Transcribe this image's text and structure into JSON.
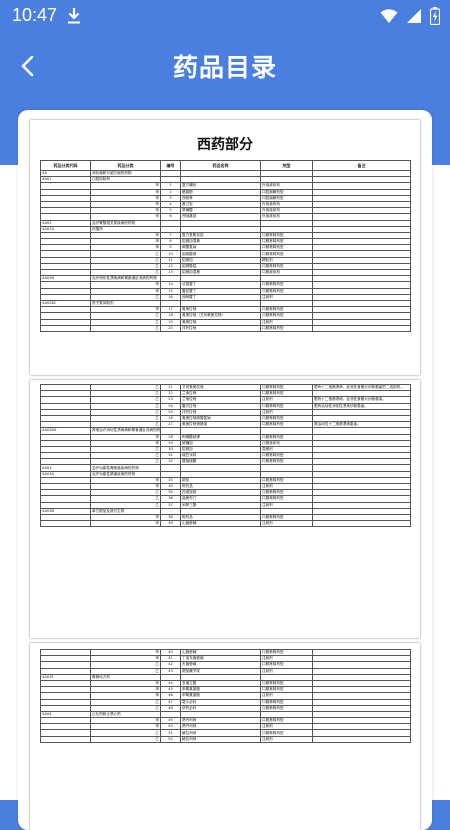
{
  "status": {
    "time": "10:47"
  },
  "header": {
    "title": "药品目录"
  },
  "document": {
    "title": "西药部分",
    "columns": [
      "药品分类代码",
      "药品分类",
      "编号",
      "药品名称",
      "剂型",
      "备注"
    ],
    "page1_rows": [
      [
        "XA",
        "消化道和代谢方面的药物",
        "",
        "",
        "",
        ""
      ],
      [
        "XA01",
        "口腔科制剂",
        "",
        "",
        "",
        ""
      ],
      [
        "",
        "甲",
        "1",
        "复方硼砂",
        "外用液体剂",
        ""
      ],
      [
        "",
        "甲",
        "2",
        "醋氯酚",
        "口腔崩解剂型",
        ""
      ],
      [
        "",
        "甲",
        "3",
        "西帕林",
        "口腔崩解剂型",
        ""
      ],
      [
        "",
        "甲",
        "4",
        "氯己定",
        "外用液体剂",
        ""
      ],
      [
        "",
        "甲",
        "5",
        "草磺酸",
        "外用液体剂",
        ""
      ],
      [
        "",
        "甲",
        "6",
        "西吡氯铵",
        "外用液体剂",
        ""
      ],
      [
        "XA02",
        "治疗胃酸相关类疾病的药物",
        "",
        "",
        "",
        ""
      ],
      [
        "XA02A",
        "抗酸药",
        "",
        "",
        "",
        ""
      ],
      [
        "",
        "甲",
        "7",
        "复方氢氧化铝",
        "口服常释剂型",
        ""
      ],
      [
        "",
        "甲",
        "8",
        "铝镁加混悬",
        "口服常释剂型",
        ""
      ],
      [
        "",
        "甲",
        "9",
        "碳酸氢钠",
        "口服常释剂型",
        ""
      ],
      [
        "",
        "乙",
        "10",
        "铝碳酸镁",
        "口服常释剂型",
        ""
      ],
      [
        "",
        "乙",
        "11",
        "铝镁加",
        "颗粒剂",
        ""
      ],
      [
        "",
        "乙",
        "12",
        "铝镁酸铝",
        "口服常释剂型",
        ""
      ],
      [
        "",
        "乙",
        "13",
        "铝镁加混悬",
        "口服液体剂",
        ""
      ],
      [
        "XA02B",
        "治疗消化性溃疡病和胃食道反流病的药物",
        "",
        "",
        "",
        ""
      ],
      [
        "",
        "甲",
        "14",
        "法莫替丁",
        "口服常释剂型",
        ""
      ],
      [
        "",
        "甲",
        "15",
        "雷尼替丁",
        "口服常释剂型",
        ""
      ],
      [
        "",
        "乙",
        "16",
        "西咪替丁",
        "注射剂",
        ""
      ],
      [
        "XA02BC",
        "质子泵抑制剂",
        "",
        "",
        "",
        ""
      ],
      [
        "",
        "甲",
        "17",
        "奥美拉唑",
        "口服常释剂型",
        ""
      ],
      [
        "",
        "乙",
        "18",
        "奥美拉唑（艾司奥美拉唑）",
        "口服常释剂型",
        ""
      ],
      [
        "",
        "乙",
        "19",
        "奥美拉唑",
        "注射剂",
        ""
      ],
      [
        "",
        "乙",
        "20",
        "泮托拉唑",
        "口服常释剂型",
        ""
      ]
    ],
    "page2_rows": [
      [
        "",
        "乙",
        "21",
        "艾司奥美拉唑",
        "口服常释剂型",
        "限有十二指肠溃疡、反流性食管炎诊断患者的二线用药。"
      ],
      [
        "",
        "乙",
        "22",
        "兰索拉唑",
        "口服常释剂型",
        ""
      ],
      [
        "",
        "乙",
        "23",
        "兰索拉唑",
        "注射剂",
        "限有十二指肠溃疡、反流性食管炎诊断患者。"
      ],
      [
        "",
        "乙",
        "24",
        "雷贝拉唑",
        "口服常释剂型",
        "限有活动性消化性溃疡诊断患者。"
      ],
      [
        "",
        "乙",
        "25",
        "泮托拉唑",
        "注射剂",
        ""
      ],
      [
        "",
        "乙",
        "26",
        "奥美拉唑碳酸氢钠",
        "口服常释剂型",
        ""
      ],
      [
        "",
        "乙",
        "27",
        "奥美拉唑镁肠溶",
        "口服常释剂型",
        "限活动性十二指肠溃疡患者。"
      ],
      [
        "XA02BX",
        "其他治疗消化性溃疡病和胃食道反流病的药物",
        "",
        "",
        "",
        ""
      ],
      [
        "",
        "甲",
        "28",
        "枸橼酸铋钾",
        "口服常释剂型",
        ""
      ],
      [
        "",
        "甲",
        "29",
        "硫糖铝",
        "口服液体剂",
        ""
      ],
      [
        "",
        "乙",
        "30",
        "铝镁加",
        "混悬剂",
        ""
      ],
      [
        "",
        "乙",
        "31",
        "瑞巴派特",
        "口服常释剂型",
        ""
      ],
      [
        "",
        "乙",
        "32",
        "替普瑞酮",
        "口服常释剂型",
        ""
      ],
      [
        "XA03",
        "治疗功能性胃肠道疾病的药物",
        "",
        "",
        "",
        ""
      ],
      [
        "XA03A",
        "治疗功能性肠道疾病的药物",
        "",
        "",
        "",
        ""
      ],
      [
        "",
        "甲",
        "33",
        "颠茄",
        "口服常释剂型",
        ""
      ],
      [
        "",
        "甲",
        "34",
        "阿托品",
        "注射剂",
        ""
      ],
      [
        "",
        "乙",
        "35",
        "匹维溴铵",
        "口服常释剂型",
        ""
      ],
      [
        "",
        "乙",
        "36",
        "曲美布汀",
        "口服常释剂型",
        ""
      ],
      [
        "",
        "乙",
        "37",
        "间苯三酚",
        "注射剂",
        ""
      ],
      [
        "XA03B",
        "单方颠茄及其衍生物",
        "",
        "",
        "",
        ""
      ],
      [
        "",
        "甲",
        "38",
        "阿托品",
        "口服常释剂型",
        ""
      ],
      [
        "",
        "甲",
        "39",
        "山莨菪碱",
        "注射剂",
        ""
      ]
    ],
    "page3_rows": [
      [
        "",
        "甲",
        "40",
        "山莨菪碱",
        "口服常释剂型",
        ""
      ],
      [
        "",
        "甲",
        "41",
        "丁溴东莨菪碱",
        "注射剂",
        ""
      ],
      [
        "",
        "乙",
        "42",
        "东莨菪碱",
        "口服常释剂型",
        ""
      ],
      [
        "",
        "乙",
        "43",
        "颠茄磺苄啶",
        "注射剂",
        ""
      ],
      [
        "XA03F",
        "胃肠动力药",
        "",
        "",
        "",
        ""
      ],
      [
        "",
        "甲",
        "44",
        "多潘立酮",
        "口服常释剂型",
        ""
      ],
      [
        "",
        "甲",
        "45",
        "甲氧氯普胺",
        "口服常释剂型",
        ""
      ],
      [
        "",
        "甲",
        "46",
        "甲氧氯普胺",
        "注射剂",
        ""
      ],
      [
        "",
        "乙",
        "47",
        "莫沙必利",
        "口服常释剂型",
        ""
      ],
      [
        "",
        "乙",
        "48",
        "伊托必利",
        "口服常释剂型",
        ""
      ],
      [
        "XA04",
        "止吐药和止恶心药",
        "",
        "",
        "",
        ""
      ],
      [
        "",
        "甲",
        "49",
        "昂丹司琼",
        "口服常释剂型",
        ""
      ],
      [
        "",
        "甲",
        "50",
        "昂丹司琼",
        "注射剂",
        ""
      ],
      [
        "",
        "乙",
        "51",
        "格拉司琼",
        "口服常释剂型",
        ""
      ],
      [
        "",
        "乙",
        "52",
        "格拉司琼",
        "注射剂",
        ""
      ]
    ]
  }
}
